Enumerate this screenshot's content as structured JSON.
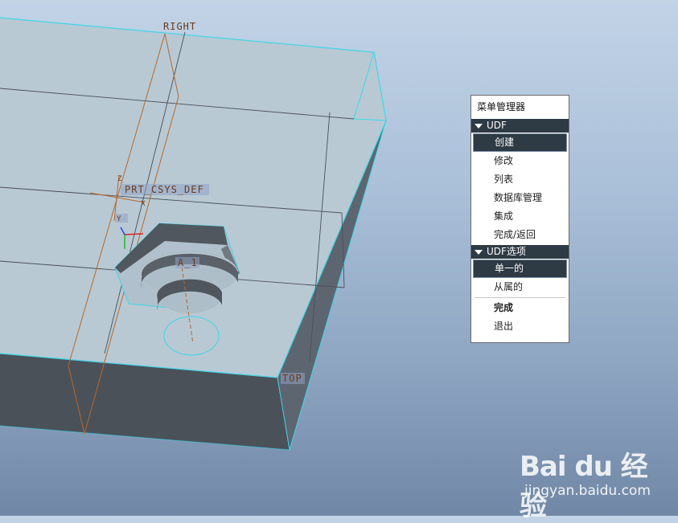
{
  "viewport": {
    "datum_labels": {
      "right": "RIGHT",
      "top": "TOP",
      "csys": "PRT_CSYS_DEF",
      "axis": "A_1",
      "csys_z": "Z",
      "csys_x": "X",
      "csys_y": "Y"
    }
  },
  "menu": {
    "title": "菜单管理器",
    "section_udf": "UDF",
    "udf_items": [
      {
        "label": "创建",
        "selected": true
      },
      {
        "label": "修改"
      },
      {
        "label": "列表"
      },
      {
        "label": "数据库管理"
      },
      {
        "label": "集成"
      },
      {
        "label": "完成/返回"
      }
    ],
    "section_options": "UDF选项",
    "option_items": [
      {
        "label": "单一的",
        "selected": true
      },
      {
        "label": "从属的"
      }
    ],
    "done": "完成",
    "quit": "退出"
  },
  "watermark": {
    "logo": "Bai du 经验",
    "url": "jingyan.baidu.com"
  }
}
